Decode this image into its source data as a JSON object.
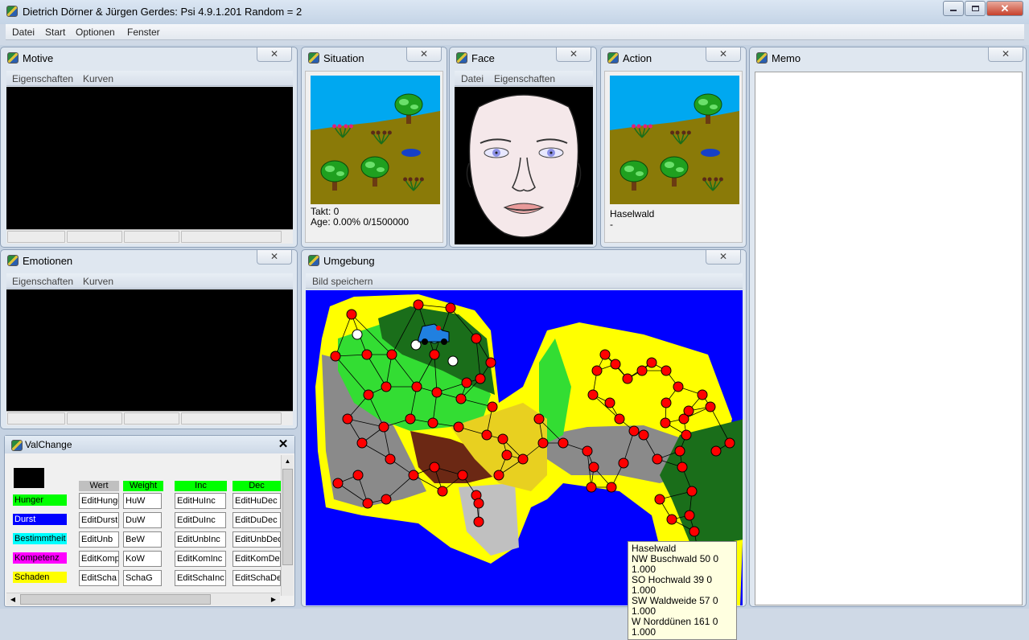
{
  "app": {
    "title": "Dietrich Dörner & Jürgen Gerdes: Psi 4.9.1.201 Random = 2"
  },
  "menu": [
    "Datei",
    "Start",
    "Optionen",
    "Fenster"
  ],
  "windows": {
    "motive": {
      "title": "Motive",
      "menu": [
        "Eigenschaften",
        "Kurven"
      ]
    },
    "emotionen": {
      "title": "Emotionen",
      "menu": [
        "Eigenschaften",
        "Kurven"
      ]
    },
    "situation": {
      "title": "Situation",
      "takt": "Takt: 0",
      "age": "Age: 0.00% 0/1500000"
    },
    "face": {
      "title": "Face",
      "menu": [
        "Datei",
        "Eigenschaften"
      ]
    },
    "action": {
      "title": "Action",
      "location": "Haselwald",
      "line2": "-"
    },
    "memo": {
      "title": "Memo"
    },
    "umgebung": {
      "title": "Umgebung",
      "menu": [
        "Bild speichern"
      ],
      "info": [
        "Haselwald",
        "NW Buschwald 50 0 1.000",
        "SO Hochwald 39 0 1.000",
        "SW Waldweide 57 0 1.000",
        "W Norddünen 161 0 1.000"
      ]
    },
    "valchange": {
      "title": "ValChange",
      "headers": [
        "Wert",
        "Weight",
        "Inc",
        "Dec"
      ],
      "rows": [
        {
          "label": "Hunger",
          "color": "#00ff00",
          "text_color": "#000000",
          "wert": "EditHunger",
          "weight": "HuW",
          "inc": "EditHuInc",
          "dec": "EditHuDec"
        },
        {
          "label": "Durst",
          "color": "#0000ff",
          "text_color": "#ffffff",
          "wert": "EditDurst",
          "weight": "DuW",
          "inc": "EditDuInc",
          "dec": "EditDuDec"
        },
        {
          "label": "Bestimmtheit",
          "color": "#00ffff",
          "text_color": "#000000",
          "wert": "EditUnb",
          "weight": "BeW",
          "inc": "EditUnbInc",
          "dec": "EditUnbDec"
        },
        {
          "label": "Kompetenz",
          "color": "#ff00ff",
          "text_color": "#000000",
          "wert": "EditKomp",
          "weight": "KoW",
          "inc": "EditKomInc",
          "dec": "EditKomDec"
        },
        {
          "label": "Schaden",
          "color": "#ffff00",
          "text_color": "#000000",
          "wert": "EditScha",
          "weight": "SchaG",
          "inc": "EditSchaInc",
          "dec": "EditSchaDec"
        }
      ]
    }
  },
  "colors": {
    "water": "#0000ff",
    "sand": "#ffff00",
    "forest": "#1a6e1a",
    "meadow": "#33dd33",
    "rock": "#888888",
    "node": "#ff0000"
  }
}
